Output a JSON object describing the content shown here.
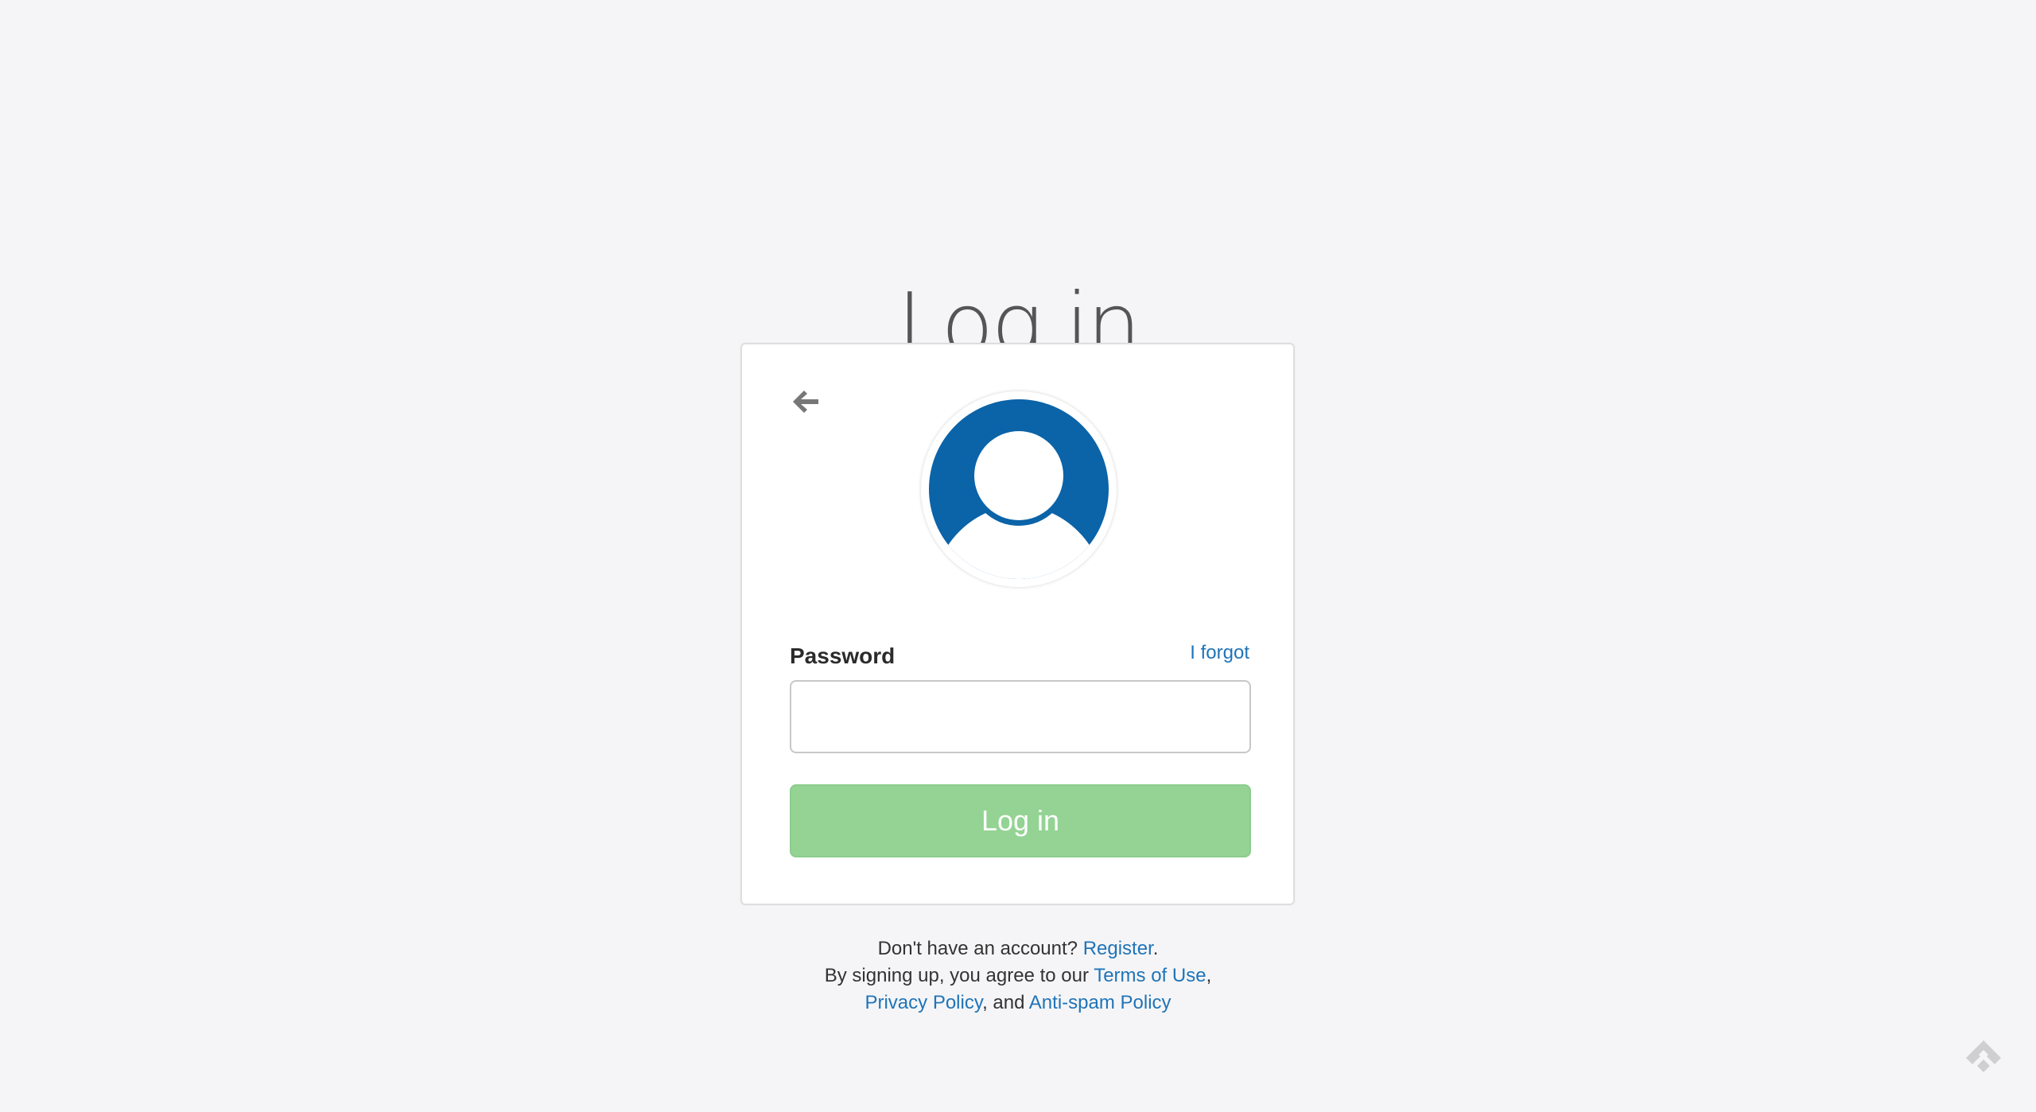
{
  "page": {
    "title": "Log in"
  },
  "form": {
    "back_icon": "arrow-left-icon",
    "avatar_icon": "user-avatar-icon",
    "password_label": "Password",
    "forgot_label": "I forgot",
    "password_value": "",
    "password_placeholder": "",
    "submit_label": "Log in"
  },
  "footer": {
    "no_account_text": "Don't have an account?",
    "register_label": "Register",
    "register_suffix": ".",
    "agree_text": "By signing up, you agree to our",
    "terms_label": "Terms of Use",
    "comma1": ",",
    "privacy_label": "Privacy Policy",
    "and_text": ", and",
    "antispam_label": "Anti-spam Policy"
  },
  "brand": {
    "logo_icon": "feedly-logo-icon"
  },
  "colors": {
    "accent": "#1f74b8",
    "avatar_blue": "#0b63a8",
    "button_green": "#94d394",
    "background": "#f5f5f7"
  }
}
